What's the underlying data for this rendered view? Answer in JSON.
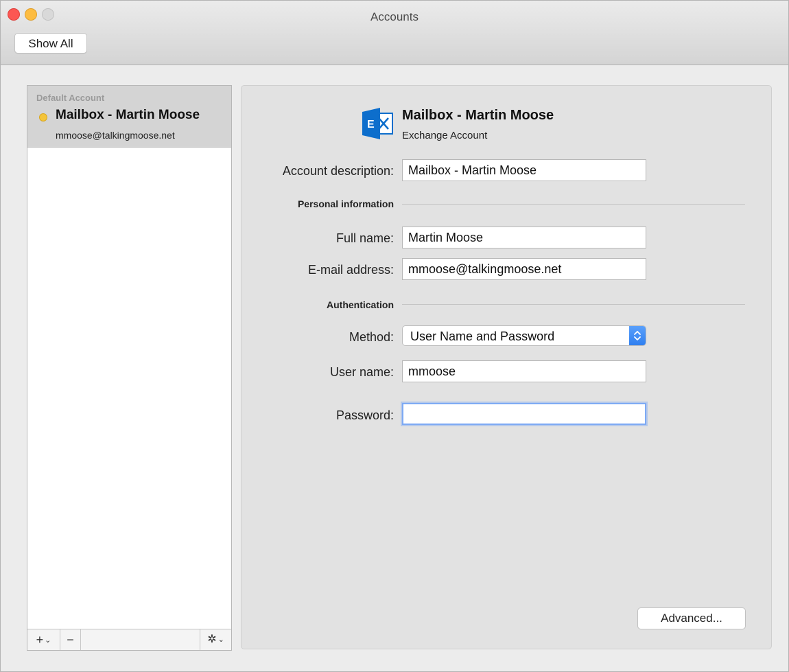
{
  "window": {
    "title": "Accounts",
    "toolbar_button": "Show All"
  },
  "sidebar": {
    "group_label": "Default Account",
    "selected_account": {
      "name": "Mailbox - Martin Moose",
      "email": "mmoose@talkingmoose.net"
    },
    "toolbar": {
      "add": "+",
      "remove": "−",
      "gear": "✲"
    }
  },
  "account": {
    "title": "Mailbox - Martin Moose",
    "type": "Exchange Account",
    "icon": "exchange-icon",
    "icon_letter": "E",
    "description_label": "Account description:",
    "description_value": "Mailbox - Martin Moose"
  },
  "personal": {
    "heading": "Personal information",
    "fullname_label": "Full name:",
    "fullname_value": "Martin Moose",
    "email_label": "E-mail address:",
    "email_value": "mmoose@talkingmoose.net"
  },
  "auth": {
    "heading": "Authentication",
    "method_label": "Method:",
    "method_value": "User Name and Password",
    "username_label": "User name:",
    "username_value": "mmoose",
    "password_label": "Password:",
    "password_value": ""
  },
  "buttons": {
    "advanced": "Advanced..."
  },
  "colors": {
    "exchange_blue": "#0d6ecc",
    "select_accent": "#2f7ff0",
    "status_dot": "#f4c43a"
  }
}
